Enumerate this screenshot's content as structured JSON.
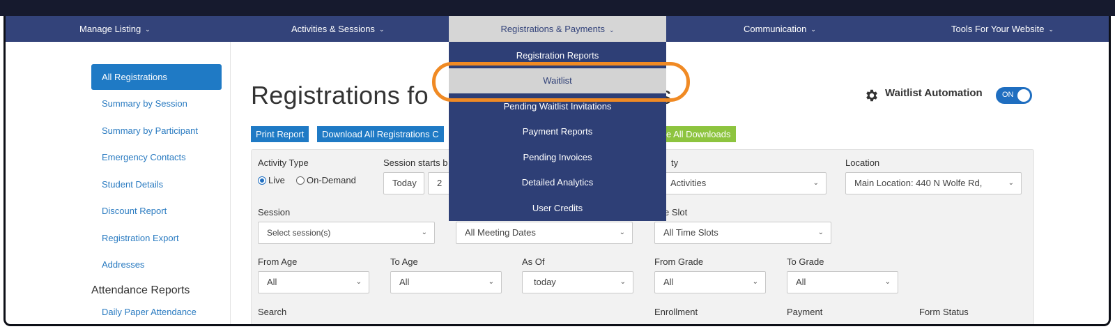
{
  "nav": {
    "items": [
      {
        "label": "Manage Listing"
      },
      {
        "label": "Activities & Sessions"
      },
      {
        "label": "Registrations & Payments"
      },
      {
        "label": "Communication"
      },
      {
        "label": "Tools For Your Website"
      }
    ],
    "dropdown": [
      "Registration Reports",
      "Waitlist",
      "Pending Waitlist Invitations",
      "Payment Reports",
      "Pending Invoices",
      "Detailed Analytics",
      "User Credits"
    ]
  },
  "sidebar": {
    "active": "All Registrations",
    "items": [
      "Summary by Session",
      "Summary by Participant",
      "Emergency Contacts",
      "Student Details",
      "Discount Report",
      "Registration Export",
      "Addresses"
    ],
    "heading": "Attendance Reports",
    "sub_items": [
      "Daily Paper Attendance"
    ]
  },
  "page": {
    "title_left": "Registrations fo",
    "title_right": "nts",
    "waitlist_automation": "Waitlist Automation",
    "toggle_label": "ON"
  },
  "buttons": {
    "print": "Print Report",
    "download": "Download All Registrations C",
    "all_downloads": "e All Downloads"
  },
  "filters": {
    "activity_type_label": "Activity Type",
    "radio_live": "Live",
    "radio_ondemand": "On-Demand",
    "session_starts_label": "Session starts b",
    "today_btn": "Today",
    "date_partial": "2",
    "activity_label": "ty",
    "activity_value": "Activities",
    "location_label": "Location",
    "location_value": "Main Location: 440 N Wolfe Rd,",
    "session_label": "Session",
    "session_placeholder": "Select session(s)",
    "meeting_value": "All Meeting Dates",
    "time_slot_label": "e Slot",
    "time_slot_value": "All Time Slots",
    "from_age_label": "From Age",
    "from_age_value": "All",
    "to_age_label": "To Age",
    "to_age_value": "All",
    "as_of_label": "As Of",
    "as_of_value": "today",
    "from_grade_label": "From Grade",
    "from_grade_value": "All",
    "to_grade_label": "To Grade",
    "to_grade_value": "All",
    "search_label": "Search",
    "enrollment_label": "Enrollment",
    "payment_label": "Payment",
    "form_status_label": "Form Status"
  },
  "icons": {
    "gear": "gear-icon",
    "chevron": "chevron-down-icon"
  },
  "colors": {
    "nav_bg": "#33437a",
    "accent_blue": "#1f7ac5",
    "accent_green": "#8dc43f",
    "highlight_ring": "#f08a24"
  }
}
